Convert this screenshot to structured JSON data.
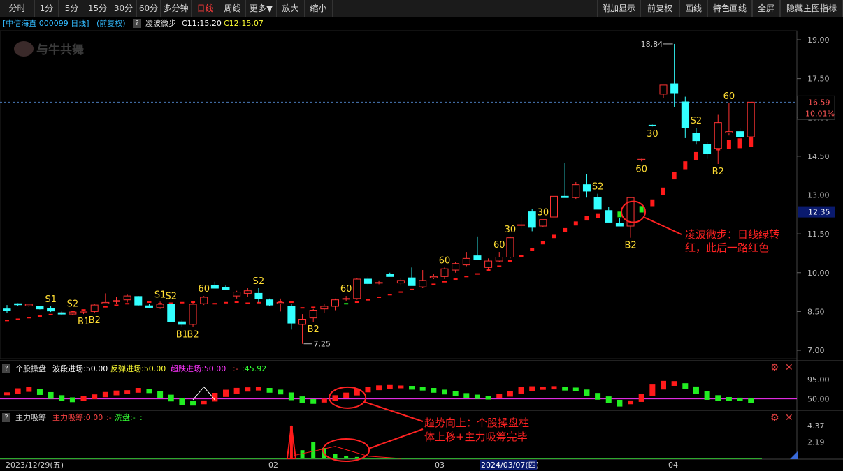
{
  "toolbar": {
    "left_buttons": [
      "分时",
      "1分",
      "5分",
      "15分",
      "30分",
      "60分",
      "多分钟",
      "日线",
      "周线",
      "更多▼",
      "放大",
      "缩小"
    ],
    "active": "日线",
    "right_buttons": [
      "附加显示",
      "前复权",
      "画线",
      "特色画线",
      "全屏",
      "隐藏主图指标"
    ]
  },
  "header": {
    "stock": "[中信海直 000099 日线]",
    "adjust": "(前复权)",
    "qmark": "?",
    "indicator": "凌波微步",
    "c1": "C11:15.20",
    "c2": "C12:15.07"
  },
  "colors": {
    "up": "#ff3333",
    "down": "#33ffff",
    "signal": "#ffdd33",
    "dotred": "#ff1a1a",
    "dotgreen": "#22ee22",
    "magenta": "#ff33ff",
    "annot": "#ff2222",
    "bg": "#000000"
  },
  "price_axis": {
    "ticks": [
      "19.00",
      "17.50",
      "16.00",
      "14.50",
      "13.00",
      "11.50",
      "10.00",
      "8.50",
      "7.00"
    ],
    "min": 7.0,
    "max": 19.0
  },
  "price_labels": {
    "current": "16.59",
    "pct": "10.01%",
    "cursor": "12.35",
    "high": "18.84",
    "low": "7.25"
  },
  "watermark": "与牛共舞",
  "annotation1": {
    "line1": "凌波微步：日线绿转",
    "line2": "红，此后一路红色"
  },
  "annotation2": {
    "line1": "趋势向上：个股操盘柱",
    "line2": "体上移+主力吸筹完毕"
  },
  "panel1": {
    "qmark": "?",
    "name": "个股操盘",
    "bd": "波段进场:50.00",
    "ft": "反弹进场:50.00",
    "cd": "超跌进场:50.00",
    "extra": ":-",
    "val": ":45.92",
    "ticks": [
      "95.00",
      "50.00"
    ]
  },
  "panel2": {
    "qmark": "?",
    "name": "主力吸筹",
    "zl": "主力吸筹:0.00",
    "sep": ":-",
    "xp": "洗盘:-",
    "end": ":",
    "ticks": [
      "4.37",
      "2.19"
    ]
  },
  "dates": {
    "start": "2023/12/29(五)",
    "m02": "02",
    "m03": "03",
    "cursor": "2024/03/07(四)",
    "m04": "04"
  },
  "chart_data": {
    "type": "candlestick",
    "ylim": [
      7.0,
      19.0
    ],
    "candles": [
      [
        8.6,
        8.75,
        8.45,
        8.55
      ],
      [
        8.8,
        8.82,
        8.72,
        8.76
      ],
      [
        8.72,
        8.8,
        8.68,
        8.78
      ],
      [
        8.7,
        8.72,
        8.58,
        8.6
      ],
      [
        8.62,
        8.7,
        8.48,
        8.52
      ],
      [
        8.45,
        8.5,
        8.36,
        8.4
      ],
      [
        8.4,
        8.52,
        8.36,
        8.48
      ],
      [
        8.48,
        8.55,
        8.4,
        8.52
      ],
      [
        8.5,
        8.8,
        8.45,
        8.75
      ],
      [
        8.8,
        9.2,
        8.78,
        8.85
      ],
      [
        8.88,
        9.05,
        8.8,
        8.92
      ],
      [
        8.95,
        9.15,
        8.85,
        9.1
      ],
      [
        9.08,
        9.1,
        8.7,
        8.75
      ],
      [
        8.72,
        8.8,
        8.62,
        8.66
      ],
      [
        8.65,
        8.88,
        8.6,
        8.78
      ],
      [
        8.78,
        8.82,
        8.32,
        8.1
      ],
      [
        8.1,
        8.18,
        7.9,
        8.0
      ],
      [
        8.0,
        8.85,
        7.9,
        8.78
      ],
      [
        8.8,
        9.1,
        8.75,
        9.05
      ],
      [
        9.5,
        9.65,
        9.4,
        9.4
      ],
      [
        9.42,
        9.5,
        9.32,
        9.36
      ],
      [
        9.1,
        9.3,
        9.0,
        9.25
      ],
      [
        9.2,
        9.4,
        9.05,
        9.3
      ],
      [
        9.2,
        9.4,
        8.85,
        9.0
      ],
      [
        8.95,
        9.0,
        8.7,
        8.75
      ],
      [
        8.8,
        9.0,
        8.5,
        8.85
      ],
      [
        8.7,
        8.8,
        7.8,
        8.05
      ],
      [
        8.0,
        8.4,
        7.25,
        8.2
      ],
      [
        8.25,
        8.6,
        8.1,
        8.55
      ],
      [
        8.6,
        8.8,
        8.45,
        8.7
      ],
      [
        8.7,
        9.0,
        8.55,
        8.95
      ],
      [
        9.0,
        9.1,
        8.9,
        9.0
      ],
      [
        9.0,
        9.8,
        8.95,
        9.75
      ],
      [
        9.75,
        9.85,
        9.5,
        9.58
      ],
      [
        9.6,
        9.7,
        9.55,
        9.62
      ],
      [
        9.95,
        10.0,
        9.85,
        9.85
      ],
      [
        9.6,
        9.8,
        9.5,
        9.7
      ],
      [
        9.8,
        10.2,
        9.6,
        9.5
      ],
      [
        9.45,
        10.1,
        9.4,
        9.7
      ],
      [
        9.8,
        9.95,
        9.75,
        9.85
      ],
      [
        9.85,
        10.2,
        9.75,
        10.15
      ],
      [
        10.1,
        10.4,
        10.0,
        10.35
      ],
      [
        10.3,
        10.8,
        10.25,
        10.55
      ],
      [
        10.65,
        11.4,
        10.6,
        10.5
      ],
      [
        10.2,
        10.55,
        10.1,
        10.45
      ],
      [
        10.45,
        10.8,
        10.4,
        10.6
      ],
      [
        10.6,
        11.4,
        10.55,
        11.35
      ],
      [
        11.85,
        12.2,
        11.7,
        11.85
      ],
      [
        12.35,
        12.45,
        11.6,
        11.75
      ],
      [
        11.8,
        12.05,
        11.75,
        12.05
      ],
      [
        12.15,
        13.05,
        12.1,
        12.95
      ],
      [
        12.95,
        14.25,
        12.9,
        12.9
      ],
      [
        12.9,
        13.5,
        12.85,
        13.4
      ],
      [
        13.4,
        13.8,
        12.9,
        13.15
      ],
      [
        12.9,
        13.05,
        12.6,
        12.45
      ],
      [
        12.4,
        12.55,
        12.05,
        11.95
      ],
      [
        11.9,
        12.1,
        11.8,
        11.8
      ],
      [
        11.8,
        12.9,
        11.35,
        12.9
      ],
      [
        14.35,
        14.4,
        14.3,
        14.38
      ],
      [
        15.7,
        15.72,
        15.65,
        15.68
      ],
      [
        16.9,
        17.2,
        16.75,
        17.25
      ],
      [
        17.3,
        18.84,
        16.4,
        16.95
      ],
      [
        16.6,
        16.8,
        15.2,
        15.6
      ],
      [
        15.4,
        15.6,
        14.95,
        15.1
      ],
      [
        14.95,
        15.05,
        14.4,
        14.6
      ],
      [
        14.8,
        16.1,
        14.2,
        15.8
      ],
      [
        15.4,
        16.55,
        15.3,
        15.45
      ],
      [
        15.45,
        15.6,
        14.95,
        15.25
      ],
      [
        15.25,
        16.59,
        15.1,
        16.59
      ]
    ],
    "trail": [
      8.15,
      8.2,
      8.26,
      8.32,
      8.38,
      8.44,
      8.5,
      8.56,
      8.62,
      8.68,
      8.74,
      8.8,
      8.84,
      8.86,
      8.8,
      8.82,
      8.84,
      8.86,
      8.86,
      8.8,
      8.84,
      8.86,
      8.82,
      8.84,
      8.84,
      8.86,
      8.86,
      8.64,
      8.66,
      8.7,
      8.72,
      8.8,
      8.86,
      8.95,
      9.05,
      9.15,
      9.25,
      9.35,
      9.45,
      9.55,
      9.65,
      9.75,
      9.85,
      9.95,
      10.1,
      10.25,
      10.45,
      10.65,
      10.9,
      11.15,
      11.4,
      11.65,
      11.9,
      12.1,
      12.2,
      12.26,
      12.25,
      12.28,
      12.45,
      12.7,
      13.15,
      13.75,
      14.15,
      14.5,
      14.75,
      14.9,
      14.95,
      15.0,
      15.05
    ],
    "trail_green": [
      30,
      31,
      56,
      57,
      58
    ],
    "signals": [
      {
        "i": 4,
        "t": "S1",
        "pos": "above"
      },
      {
        "i": 6,
        "t": "S2",
        "pos": "above"
      },
      {
        "i": 7,
        "t": "B1",
        "pos": "below"
      },
      {
        "i": 8,
        "t": "B2",
        "pos": "below"
      },
      {
        "i": 14,
        "t": "S1",
        "pos": "above"
      },
      {
        "i": 15,
        "t": "S2",
        "pos": "above"
      },
      {
        "i": 16,
        "t": "B1",
        "pos": "below"
      },
      {
        "i": 17,
        "t": "B2",
        "pos": "below"
      },
      {
        "i": 18,
        "t": "60",
        "pos": "above"
      },
      {
        "i": 23,
        "t": "S2",
        "pos": "above"
      },
      {
        "i": 28,
        "t": "B2",
        "pos": "below"
      },
      {
        "i": 31,
        "t": "60",
        "pos": "above"
      },
      {
        "i": 40,
        "t": "60",
        "pos": "above"
      },
      {
        "i": 45,
        "t": "60",
        "pos": "above"
      },
      {
        "i": 46,
        "t": "30",
        "pos": "above"
      },
      {
        "i": 49,
        "t": "30",
        "pos": "above"
      },
      {
        "i": 54,
        "t": "S2",
        "pos": "above"
      },
      {
        "i": 57,
        "t": "B2",
        "pos": "below"
      },
      {
        "i": 58,
        "t": "60",
        "pos": "below"
      },
      {
        "i": 59,
        "t": "30",
        "pos": "below"
      },
      {
        "i": 63,
        "t": "S2",
        "pos": "above"
      },
      {
        "i": 65,
        "t": "B2",
        "pos": "below"
      },
      {
        "i": 66,
        "t": "60",
        "pos": "above"
      }
    ],
    "osc": [
      62,
      68,
      72,
      66,
      58,
      52,
      48,
      51,
      55,
      60,
      64,
      66,
      70,
      68,
      60,
      52,
      44,
      40,
      42,
      54,
      63,
      69,
      72,
      74,
      70,
      66,
      56,
      48,
      44,
      46,
      52,
      58,
      66,
      72,
      76,
      78,
      78,
      76,
      74,
      70,
      66,
      62,
      58,
      55,
      53,
      56,
      62,
      70,
      74,
      75,
      76,
      74,
      72,
      64,
      56,
      48,
      40,
      42,
      52,
      70,
      82,
      86,
      80,
      70,
      58,
      52,
      50,
      49,
      46
    ],
    "main_bars": [
      0,
      0,
      0,
      0,
      0,
      0,
      0,
      0,
      0,
      0,
      0,
      0,
      0,
      0,
      0,
      0,
      0,
      0,
      0,
      0,
      0,
      0,
      0,
      0,
      0,
      0,
      4.37,
      1.1,
      2.19,
      1.4,
      0.6,
      0.35,
      0.2,
      0.1,
      0,
      0,
      0,
      0,
      0,
      0,
      0,
      0,
      0,
      0,
      0,
      0,
      0,
      0,
      0,
      0,
      0,
      0,
      0,
      0,
      0,
      0,
      0,
      0,
      0,
      0,
      0,
      0,
      0,
      0,
      0,
      0,
      0,
      0,
      0
    ]
  }
}
